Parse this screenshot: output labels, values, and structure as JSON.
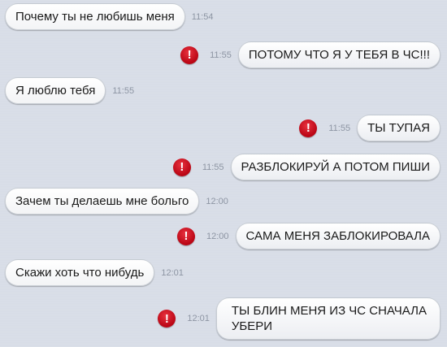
{
  "messages": [
    {
      "dir": "in",
      "text": "Почему ты не любишь меня",
      "time": "11:54"
    },
    {
      "dir": "out",
      "text": "ПОТОМУ ЧТО Я У ТЕБЯ В ЧС!!!",
      "time": "11:55",
      "error": true
    },
    {
      "dir": "in",
      "text": "Я люблю тебя",
      "time": "11:55"
    },
    {
      "dir": "out",
      "text": "ТЫ ТУПАЯ",
      "time": "11:55",
      "error": true
    },
    {
      "dir": "out",
      "text": "РАЗБЛОКИРУЙ А ПОТОМ ПИШИ",
      "time": "11:55",
      "error": true
    },
    {
      "dir": "in",
      "text": "Зачем ты делаешь мне больго",
      "time": "12:00"
    },
    {
      "dir": "out",
      "text": "САМА МЕНЯ ЗАБЛОКИРОВАЛА",
      "time": "12:00",
      "error": true
    },
    {
      "dir": "in",
      "text": "Скажи хоть что нибудь",
      "time": "12:01"
    },
    {
      "dir": "out",
      "text_line1": "ТЫ БЛИН МЕНЯ ИЗ ЧС СНАЧАЛА",
      "text_line2": "УБЕРИ",
      "time": "12:01",
      "error": true
    }
  ],
  "error_glyph": "!",
  "colors": {
    "error": "#c8101e",
    "time": "#8d95a3",
    "background": "#d8dde7"
  }
}
